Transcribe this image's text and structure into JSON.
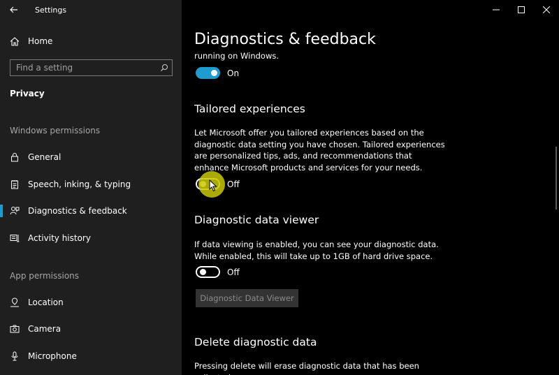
{
  "app": {
    "title": "Settings"
  },
  "sidebar": {
    "home_label": "Home",
    "search_placeholder": "Find a setting",
    "section": "Privacy",
    "windows_permissions_title": "Windows permissions",
    "app_permissions_title": "App permissions",
    "items": [
      {
        "label": "General",
        "icon": "lock-icon",
        "selected": false
      },
      {
        "label": "Speech, inking, & typing",
        "icon": "notepad-icon",
        "selected": false
      },
      {
        "label": "Diagnostics & feedback",
        "icon": "feedback-icon",
        "selected": true
      },
      {
        "label": "Activity history",
        "icon": "activity-icon",
        "selected": false
      },
      {
        "label": "Location",
        "icon": "location-icon",
        "selected": false
      },
      {
        "label": "Camera",
        "icon": "camera-icon",
        "selected": false
      },
      {
        "label": "Microphone",
        "icon": "microphone-icon",
        "selected": false
      }
    ]
  },
  "main": {
    "title": "Diagnostics & feedback",
    "truncated_text": "running on Windows.",
    "toggle1": {
      "state": "on",
      "label": "On"
    },
    "tailored": {
      "heading": "Tailored experiences",
      "description": "Let Microsoft offer you tailored experiences based on the diagnostic data setting you have chosen. Tailored experiences are personalized tips, ads, and recommendations that enhance Microsoft products and services for your needs.",
      "toggle": {
        "state": "off",
        "label": "Off"
      }
    },
    "viewer": {
      "heading": "Diagnostic data viewer",
      "description": "If data viewing is enabled, you can see your diagnostic data. While enabled, this will take up to 1GB of hard drive space.",
      "toggle": {
        "state": "off",
        "label": "Off"
      },
      "button_label": "Diagnostic Data Viewer"
    },
    "delete": {
      "heading": "Delete diagnostic data",
      "description": "Pressing delete will erase diagnostic data that has been collected"
    }
  },
  "colors": {
    "accent": "#1e9ccf",
    "sidebar_bg": "#1f1f1f",
    "main_bg": "#000000",
    "cursor_highlight": "#c8c800"
  }
}
